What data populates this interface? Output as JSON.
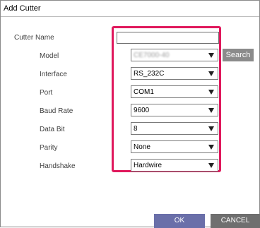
{
  "window": {
    "title": "Add Cutter"
  },
  "form": {
    "cutter_name": {
      "label": "Cutter Name",
      "value": ""
    },
    "model": {
      "label": "Model",
      "value": "CE7000-40"
    },
    "interface": {
      "label": "Interface",
      "value": "RS_232C"
    },
    "port": {
      "label": "Port",
      "value": "COM1"
    },
    "baud_rate": {
      "label": "Baud Rate",
      "value": "9600"
    },
    "data_bit": {
      "label": "Data Bit",
      "value": "8"
    },
    "parity": {
      "label": "Parity",
      "value": "None"
    },
    "handshake": {
      "label": "Handshake",
      "value": "Hardwire"
    }
  },
  "buttons": {
    "search": "Search",
    "ok": "OK",
    "cancel": "CANCEL"
  },
  "colors": {
    "highlight": "#e0185c",
    "ok_button": "#6a6fa9",
    "cancel_button": "#6f6f6f",
    "search_button": "#8b8b8b"
  },
  "icons": {
    "dropdown": "triangle-down"
  }
}
